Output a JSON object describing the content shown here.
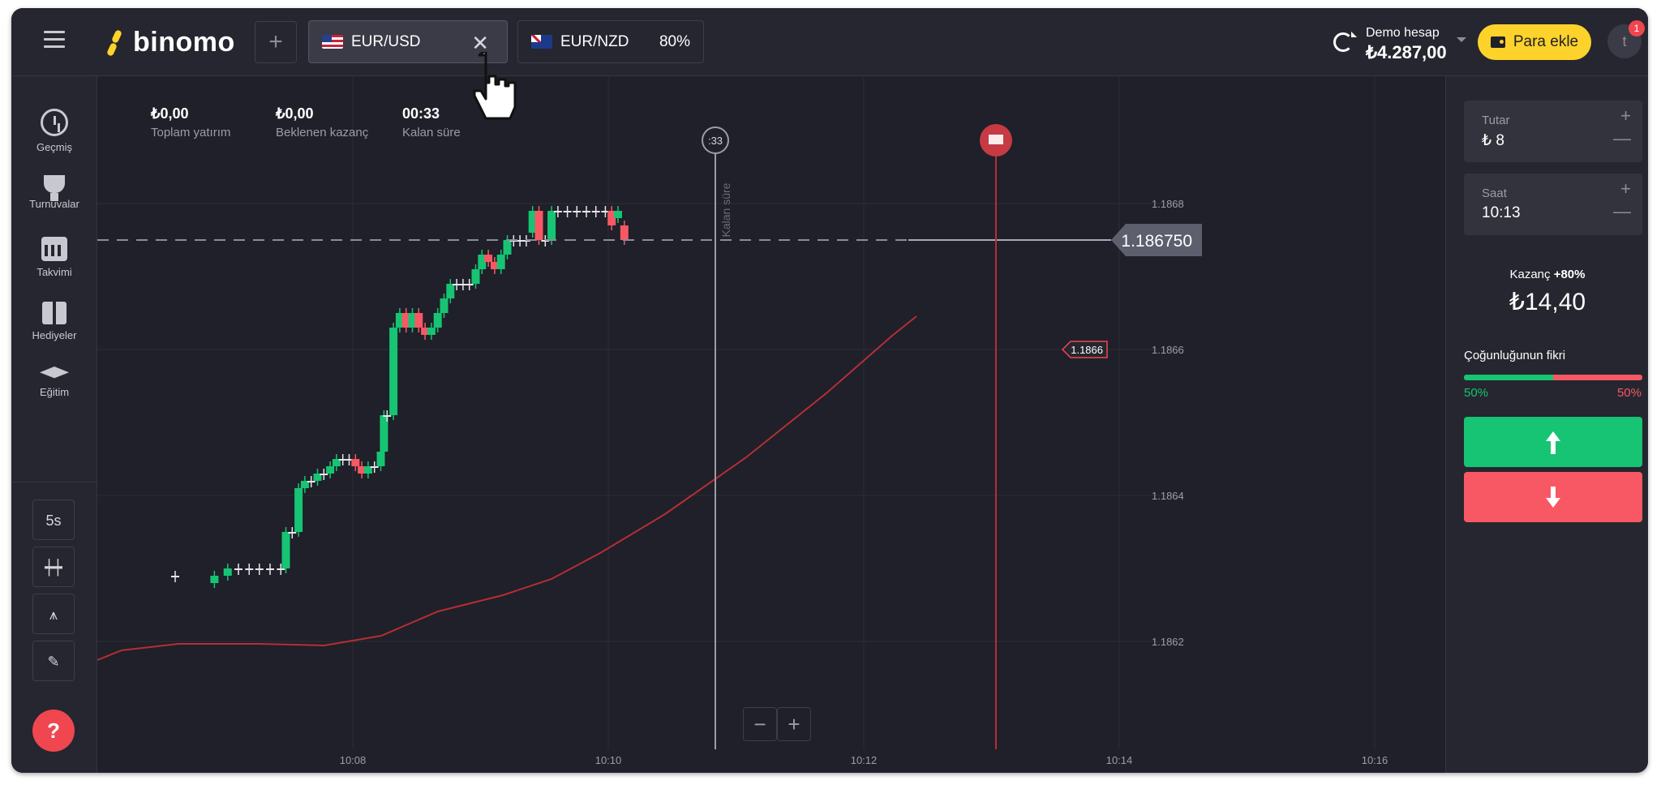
{
  "brand": {
    "name": "binomo",
    "color": "#fdd22b"
  },
  "tabs": [
    {
      "pair": "EUR/USD",
      "flag": "us-flag-icon",
      "active": true
    },
    {
      "pair": "EUR/NZD",
      "flag": "nz-flag-icon",
      "payout": "80%"
    }
  ],
  "account": {
    "label": "Demo hesap",
    "balance": "₺4.287,00",
    "deposit_label": "Para ekle",
    "avatar": "t",
    "notifications": "1"
  },
  "nav": {
    "items": [
      {
        "label": "Geçmiş",
        "icon": "clock-icon"
      },
      {
        "label": "Turnuvalar",
        "icon": "trophy-icon"
      },
      {
        "label": "Takvimi",
        "icon": "calendar-icon"
      },
      {
        "label": "Hediyeler",
        "icon": "gift-icon"
      },
      {
        "label": "Eğitim",
        "icon": "graduation-cap-icon"
      }
    ],
    "timeframe": "5s",
    "help": "?"
  },
  "stats": [
    {
      "value": "₺0,00",
      "label": "Toplam yatırım"
    },
    {
      "value": "₺0,00",
      "label": "Beklenen kazanç"
    },
    {
      "value": "00:33",
      "label": "Kalan süre"
    }
  ],
  "chart": {
    "current_price": "1.186750",
    "marker_price": "1.1866",
    "y_ticks": [
      "1.1868",
      "1.1866",
      "1.1864",
      "1.1862"
    ],
    "x_ticks": [
      "10:08",
      "10:10",
      "10:12",
      "10:14",
      "10:16"
    ],
    "countdown": ":33",
    "expiry_label": "Kalan süre",
    "zoom_out": "−",
    "zoom_in": "+"
  },
  "chart_data": {
    "type": "candlestick",
    "x_ticks": [
      "10:08",
      "10:10",
      "10:12",
      "10:14",
      "10:16"
    ],
    "y_ticks": [
      1.1868,
      1.1866,
      1.1864,
      1.1862
    ],
    "ylim": [
      1.18613,
      1.18693
    ],
    "current_price": 1.18675,
    "candles": [
      {
        "t": 0.0,
        "o": 1.18629,
        "c": 1.18629
      },
      {
        "t": 0.62,
        "o": 1.18628,
        "c": 1.18629
      },
      {
        "t": 0.83,
        "o": 1.18629,
        "c": 1.1863
      },
      {
        "t": 1.0,
        "o": 1.1863,
        "c": 1.1863
      },
      {
        "t": 1.17,
        "o": 1.1863,
        "c": 1.1863
      },
      {
        "t": 1.33,
        "o": 1.1863,
        "c": 1.1863
      },
      {
        "t": 1.5,
        "o": 1.1863,
        "c": 1.1863
      },
      {
        "t": 1.67,
        "o": 1.1863,
        "c": 1.1863
      },
      {
        "t": 1.75,
        "o": 1.1863,
        "c": 1.18635
      },
      {
        "t": 1.85,
        "o": 1.18635,
        "c": 1.18635
      },
      {
        "t": 1.95,
        "o": 1.18635,
        "c": 1.18641
      },
      {
        "t": 2.05,
        "o": 1.18641,
        "c": 1.18642
      },
      {
        "t": 2.15,
        "o": 1.18642,
        "c": 1.18642
      },
      {
        "t": 2.25,
        "o": 1.18642,
        "c": 1.18643
      },
      {
        "t": 2.35,
        "o": 1.18643,
        "c": 1.18643
      },
      {
        "t": 2.45,
        "o": 1.18643,
        "c": 1.18644
      },
      {
        "t": 2.55,
        "o": 1.18644,
        "c": 1.18645
      },
      {
        "t": 2.65,
        "o": 1.18645,
        "c": 1.18645
      },
      {
        "t": 2.75,
        "o": 1.18645,
        "c": 1.18645
      },
      {
        "t": 2.85,
        "o": 1.18645,
        "c": 1.18644
      },
      {
        "t": 2.95,
        "o": 1.18644,
        "c": 1.18643
      },
      {
        "t": 3.05,
        "o": 1.18643,
        "c": 1.18644
      },
      {
        "t": 3.15,
        "o": 1.18644,
        "c": 1.18644
      },
      {
        "t": 3.25,
        "o": 1.18644,
        "c": 1.18646
      },
      {
        "t": 3.3,
        "o": 1.18646,
        "c": 1.18651
      },
      {
        "t": 3.35,
        "o": 1.18651,
        "c": 1.18651
      },
      {
        "t": 3.45,
        "o": 1.18651,
        "c": 1.18663
      },
      {
        "t": 3.55,
        "o": 1.18663,
        "c": 1.18665
      },
      {
        "t": 3.65,
        "o": 1.18665,
        "c": 1.18663
      },
      {
        "t": 3.75,
        "o": 1.18663,
        "c": 1.18665
      },
      {
        "t": 3.85,
        "o": 1.18665,
        "c": 1.18663
      },
      {
        "t": 3.95,
        "o": 1.18663,
        "c": 1.18662
      },
      {
        "t": 4.05,
        "o": 1.18662,
        "c": 1.18663
      },
      {
        "t": 4.15,
        "o": 1.18663,
        "c": 1.18665
      },
      {
        "t": 4.25,
        "o": 1.18665,
        "c": 1.18667
      },
      {
        "t": 4.35,
        "o": 1.18667,
        "c": 1.18669
      },
      {
        "t": 4.45,
        "o": 1.18669,
        "c": 1.18669
      },
      {
        "t": 4.55,
        "o": 1.18669,
        "c": 1.18669
      },
      {
        "t": 4.65,
        "o": 1.18669,
        "c": 1.18669
      },
      {
        "t": 4.75,
        "o": 1.18669,
        "c": 1.18671
      },
      {
        "t": 4.85,
        "o": 1.18671,
        "c": 1.18673
      },
      {
        "t": 4.95,
        "o": 1.18673,
        "c": 1.18672
      },
      {
        "t": 5.05,
        "o": 1.18672,
        "c": 1.18671
      },
      {
        "t": 5.15,
        "o": 1.18671,
        "c": 1.18673
      },
      {
        "t": 5.25,
        "o": 1.18673,
        "c": 1.18675
      },
      {
        "t": 5.35,
        "o": 1.18675,
        "c": 1.18675
      },
      {
        "t": 5.45,
        "o": 1.18675,
        "c": 1.18675
      },
      {
        "t": 5.55,
        "o": 1.18675,
        "c": 1.18675
      },
      {
        "t": 5.65,
        "o": 1.18676,
        "c": 1.18679
      },
      {
        "t": 5.75,
        "o": 1.18679,
        "c": 1.18675
      },
      {
        "t": 5.85,
        "o": 1.18675,
        "c": 1.18675
      },
      {
        "t": 5.95,
        "o": 1.18675,
        "c": 1.18679
      },
      {
        "t": 6.05,
        "o": 1.18679,
        "c": 1.18679
      },
      {
        "t": 6.2,
        "o": 1.18679,
        "c": 1.18679
      },
      {
        "t": 6.35,
        "o": 1.18679,
        "c": 1.18679
      },
      {
        "t": 6.5,
        "o": 1.18679,
        "c": 1.18679
      },
      {
        "t": 6.65,
        "o": 1.18679,
        "c": 1.18679
      },
      {
        "t": 6.8,
        "o": 1.18679,
        "c": 1.18679
      },
      {
        "t": 6.9,
        "o": 1.18679,
        "c": 1.18677
      },
      {
        "t": 7.0,
        "o": 1.18678,
        "c": 1.18679
      },
      {
        "t": 7.1,
        "o": 1.18677,
        "c": 1.18675
      }
    ]
  },
  "trade_panel": {
    "amount": {
      "label": "Tutar",
      "value": "₺ 8"
    },
    "time": {
      "label": "Saat",
      "value": "10:13"
    },
    "payout_label": "Kazanç",
    "payout_pct": "+80%",
    "payout_value": "₺14,40",
    "sentiment": {
      "title": "Çoğunluğunun fikri",
      "up": "50%",
      "down": "50%",
      "up_fraction": 0.5
    },
    "plus": "+",
    "minus": "—"
  }
}
